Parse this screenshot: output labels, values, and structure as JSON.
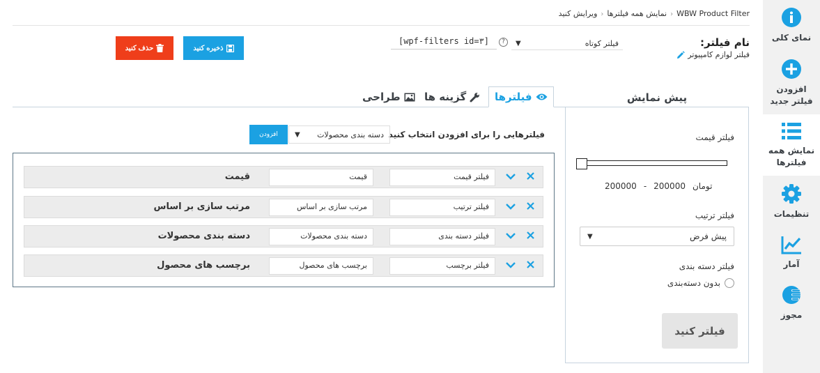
{
  "breadcrumb": {
    "home": "WBW Product Filter",
    "all": "نمایش همه فیلترها",
    "edit": "ویرایش کنید"
  },
  "filter_name": {
    "label": "نام فیلتر:",
    "value": "فیلتر لوازم کامپیوتر"
  },
  "filter_type": {
    "selected": "فیلتر کوتاه"
  },
  "help_symbol": "?",
  "shortcode": "[wpf-filters id=٣]",
  "buttons": {
    "save": "ذخیره کنید",
    "delete": "حذف کنید"
  },
  "tabs": {
    "filters": "فیلترها",
    "options": "گزینه ها",
    "design": "طراحی"
  },
  "preview": {
    "title": "پیش نمایش",
    "price_label": "فیلتر قیمت",
    "price_from": "200000",
    "price_to": "200000",
    "price_sep": "-",
    "currency": "تومان",
    "sort_label": "فیلتر ترتیب",
    "sort_selected": "پیش فرض",
    "category_label": "فیلتر دسته بندی",
    "category_option": "بدون دسته‌بندی",
    "apply_button": "فیلتر کنید"
  },
  "add_filter": {
    "label": "فیلترهایی را برای افزودن انتخاب کنید",
    "selected": "دسته بندی محصولات",
    "button": "افزودن"
  },
  "filters": [
    {
      "title": "قیمت",
      "field1": "فیلتر قیمت",
      "field2": "قیمت"
    },
    {
      "title": "مرتب سازی بر اساس",
      "field1": "فیلتر ترتیب",
      "field2": "مرتب سازی بر اساس"
    },
    {
      "title": "دسته بندی محصولات",
      "field1": "فیلتر دسته بندی",
      "field2": "دسته بندی محصولات"
    },
    {
      "title": "برچسب های محصول",
      "field1": "فیلتر برچسب",
      "field2": "برچسب های محصول"
    }
  ],
  "sidebar": {
    "items": [
      {
        "label": "نمای کلی",
        "icon": "info-icon"
      },
      {
        "label": "افزودن فیلتر جدید",
        "icon": "plus-icon"
      },
      {
        "label": "نمایش همه فیلترها",
        "icon": "list-icon"
      },
      {
        "label": "تنظیمات",
        "icon": "gear-icon"
      },
      {
        "label": "آمار",
        "icon": "chart-icon"
      },
      {
        "label": "مجوز",
        "icon": "license-icon"
      }
    ]
  },
  "colors": {
    "accent": "#1ba1e2",
    "danger": "#ef3e1a",
    "sidebar_bg": "#f1f1f1"
  }
}
